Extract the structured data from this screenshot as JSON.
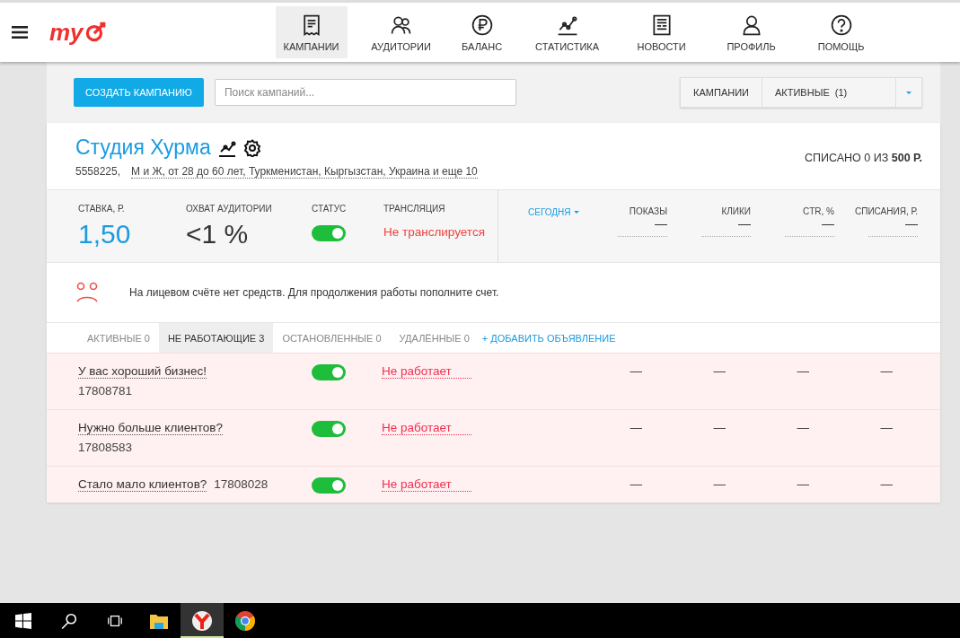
{
  "header": {
    "logo": "my",
    "nav": [
      {
        "label": "КАМПАНИИ",
        "selected": true
      },
      {
        "label": "АУДИТОРИИ",
        "selected": false
      },
      {
        "label": "БАЛАНС",
        "selected": false
      },
      {
        "label": "СТАТИСТИКА",
        "selected": false
      },
      {
        "label": "НОВОСТИ",
        "selected": false
      },
      {
        "label": "ПРОФИЛЬ",
        "selected": false
      },
      {
        "label": "ПОМОЩЬ",
        "selected": false
      }
    ]
  },
  "toolbar": {
    "create_button": "СОЗДАТЬ КАМПАНИЮ",
    "search": {
      "placeholder": "Поиск кампаний..."
    },
    "filter": {
      "label": "КАМПАНИИ",
      "value": "АКТИВНЫЕ",
      "count": "(1)"
    }
  },
  "campaign": {
    "title": "Студия Хурма",
    "id": "5558225,",
    "targeting": "М и Ж, от 28 до 60 лет, Туркменистан, Кыргызстан, Украина и еще 10",
    "spent_prefix": "СПИСАНО 0 ИЗ",
    "spent_total": "500 Р.",
    "metrics": [
      {
        "label": "СТАВКА, Р.",
        "value": "1,50",
        "kind": "rate"
      },
      {
        "label": "ОХВАТ АУДИТОРИИ",
        "value": "<1 %",
        "kind": "reach"
      },
      {
        "label": "СТАТУС",
        "on": true,
        "kind": "toggle"
      },
      {
        "label": "ТРАНСЛЯЦИЯ",
        "value": "Не транслируется",
        "kind": "alert"
      }
    ],
    "period": "СЕГОДНЯ",
    "stats": [
      {
        "label": "ПОКАЗЫ",
        "value": "—"
      },
      {
        "label": "КЛИКИ",
        "value": "—"
      },
      {
        "label": "CTR, %",
        "value": "—"
      },
      {
        "label": "СПИСАНИЯ, Р.",
        "value": "—"
      }
    ],
    "notice": "На лицевом счёте нет средств. Для продолжения работы пополните счет.",
    "tabs": [
      {
        "label": "АКТИВНЫЕ 0",
        "selected": false
      },
      {
        "label": "НЕ РАБОТАЮЩИЕ 3",
        "selected": true
      },
      {
        "label": "ОСТАНОВЛЕННЫЕ 0",
        "selected": false
      },
      {
        "label": "УДАЛЁННЫЕ 0",
        "selected": false
      }
    ],
    "add_ad": "+ ДОБАВИТЬ ОБЪЯВЛЕНИЕ",
    "ads": [
      {
        "name": "У вас хороший бизнес!",
        "id": "17808781",
        "kind": "stacked",
        "on": true,
        "status": "Не работает",
        "stats": [
          "—",
          "—",
          "—",
          "—"
        ]
      },
      {
        "name": "Нужно больше клиентов?",
        "id": "17808583",
        "kind": "stacked",
        "on": true,
        "status": "Не работает",
        "stats": [
          "—",
          "—",
          "—",
          "—"
        ]
      },
      {
        "name": "Стало мало клиентов?",
        "id": "17808028",
        "kind": "inline",
        "on": true,
        "status": "Не работает",
        "stats": [
          "—",
          "—",
          "—",
          "—"
        ]
      }
    ]
  },
  "taskbar": {
    "apps": [
      {
        "selected": false
      },
      {
        "selected": true
      },
      {
        "selected": false
      }
    ]
  }
}
